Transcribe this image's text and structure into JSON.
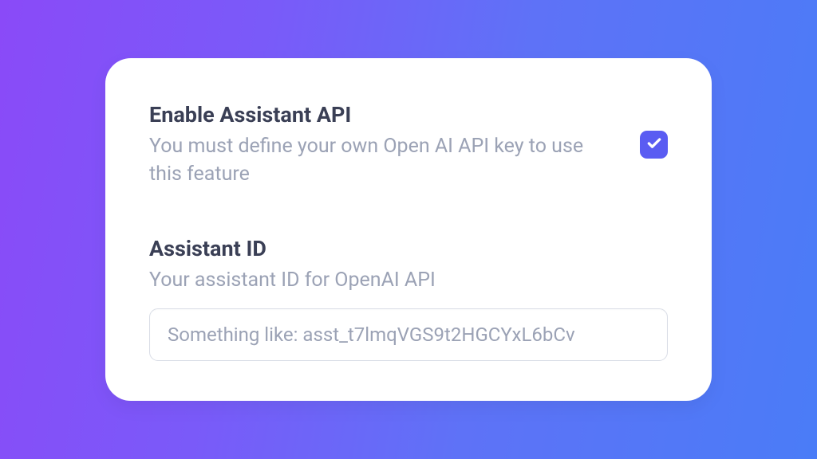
{
  "colors": {
    "accent": "#5a5cf2",
    "gradient_start": "#8a4af8",
    "gradient_end": "#4a7cf7"
  },
  "enable_section": {
    "title": "Enable Assistant API",
    "subtitle": "You must define your own Open AI API key to use this feature",
    "checked": true
  },
  "assistant_section": {
    "title": "Assistant ID",
    "subtitle": "Your assistant ID for OpenAI API",
    "input_value": "",
    "input_placeholder": "Something like: asst_t7lmqVGS9t2HGCYxL6bCv"
  }
}
